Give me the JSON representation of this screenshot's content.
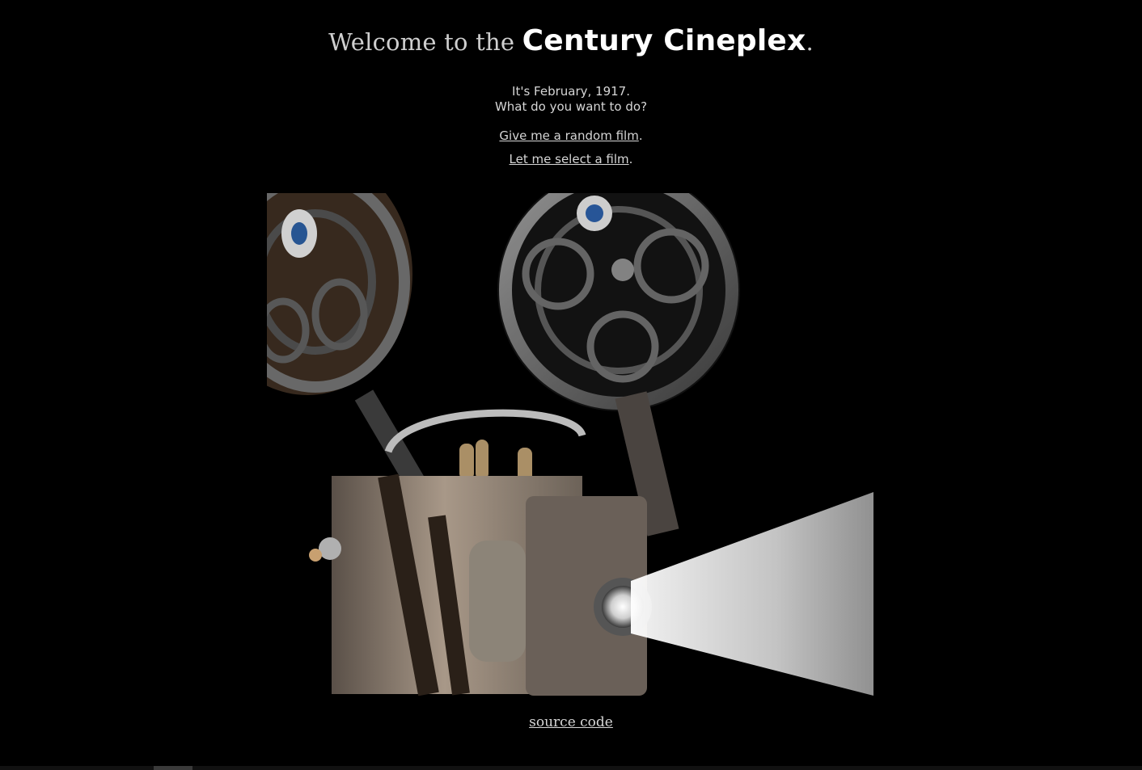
{
  "header": {
    "title_prefix": "Welcome to the ",
    "title_brand": "Century Cineplex",
    "title_suffix": "."
  },
  "intro": {
    "line1": "It's February, 1917.",
    "line2": "What do you want to do?"
  },
  "actions": {
    "random_film_label": "Give me a random film",
    "random_film_suffix": ".",
    "select_film_label": "Let me select a film",
    "select_film_suffix": "."
  },
  "footer": {
    "source_code_label": "source code"
  },
  "colors": {
    "background": "#000000",
    "text": "#d6d6d6",
    "brand": "#ffffff"
  }
}
